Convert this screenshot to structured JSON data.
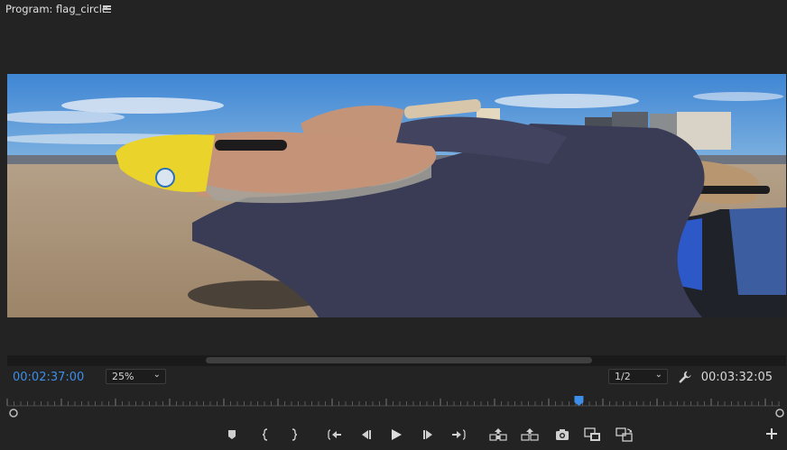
{
  "panel": {
    "title": "Program: flag_circle"
  },
  "icons": {
    "panel_menu": "hamburger-menu-icon",
    "settings": "wrench-icon",
    "add": "plus-icon"
  },
  "timecode": {
    "current": "00:02:37:00",
    "duration": "00:03:32:05"
  },
  "zoom": {
    "value": "25%"
  },
  "resolution": {
    "value": "1/2"
  },
  "playhead": {
    "position_fraction": 0.74
  },
  "colors": {
    "accent": "#3d8ee8",
    "panel_bg": "#232323",
    "text": "#d8d8d8"
  },
  "transport": [
    {
      "name": "add-marker-button",
      "icon": "marker-icon"
    },
    {
      "name": "mark-in-button",
      "icon": "mark-in-icon"
    },
    {
      "name": "mark-out-button",
      "icon": "mark-out-icon"
    },
    {
      "name": "go-to-in-button",
      "icon": "go-to-in-icon"
    },
    {
      "name": "step-back-button",
      "icon": "step-back-icon"
    },
    {
      "name": "play-button",
      "icon": "play-icon"
    },
    {
      "name": "step-forward-button",
      "icon": "step-forward-icon"
    },
    {
      "name": "go-to-out-button",
      "icon": "go-to-out-icon"
    },
    {
      "name": "lift-button",
      "icon": "lift-icon"
    },
    {
      "name": "extract-button",
      "icon": "extract-icon"
    },
    {
      "name": "export-frame-button",
      "icon": "camera-icon"
    },
    {
      "name": "comparison-view-button",
      "icon": "comparison-view-icon"
    },
    {
      "name": "proxy-toggle-button",
      "icon": "proxy-toggle-icon"
    }
  ]
}
